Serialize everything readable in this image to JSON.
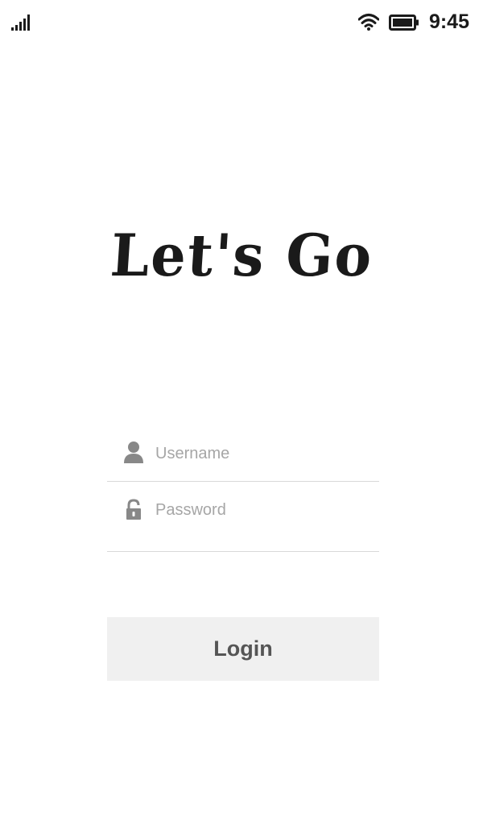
{
  "status_bar": {
    "time": "9:45",
    "signal_icon": "cellular-signal-icon",
    "wifi_icon": "wifi-icon",
    "battery_icon": "battery-full-icon"
  },
  "logo": {
    "text": "Let's Go"
  },
  "form": {
    "username": {
      "placeholder": "Username",
      "value": "",
      "icon": "person-icon"
    },
    "password": {
      "placeholder": "Password",
      "value": "",
      "icon": "lock-icon"
    }
  },
  "login_button": {
    "label": "Login"
  },
  "colors": {
    "text_dark": "#1a1a1a",
    "placeholder": "#a6a6a6",
    "icon": "#888888",
    "divider": "#d9d9d9",
    "button_bg": "#f0f0f0",
    "button_text": "#555555"
  }
}
